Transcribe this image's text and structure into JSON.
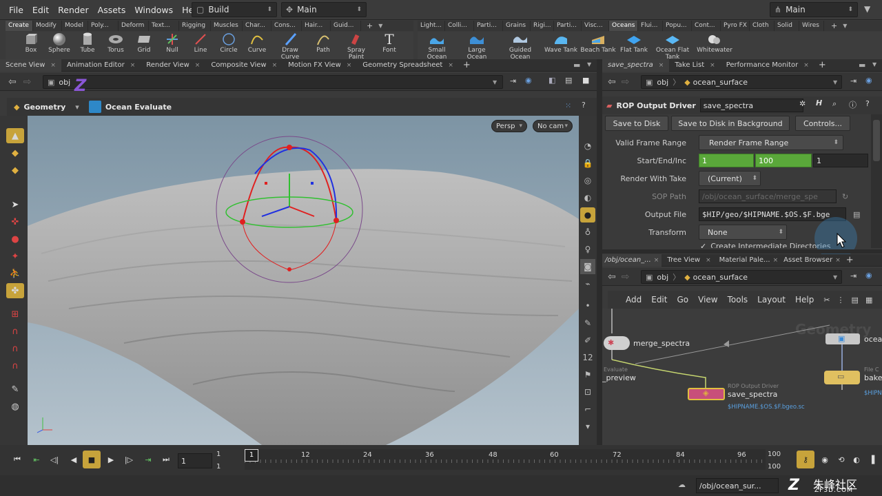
{
  "menubar": {
    "items": [
      "File",
      "Edit",
      "Render",
      "Assets",
      "Windows",
      "Help"
    ],
    "desktop": "Build",
    "context": "Main",
    "workspace": "Main"
  },
  "shelf_left": {
    "tabs": [
      "Create",
      "Modify",
      "Model",
      "Poly...",
      "Deform",
      "Text...",
      "Rigging",
      "Muscles",
      "Char...",
      "Cons...",
      "Hair...",
      "Guid..."
    ],
    "tools": [
      "Box",
      "Sphere",
      "Tube",
      "Torus",
      "Grid",
      "Null",
      "Line",
      "Circle",
      "Curve",
      "Draw Curve",
      "Path",
      "Spray Paint",
      "Font"
    ]
  },
  "shelf_right": {
    "tabs": [
      "Light...",
      "Colli...",
      "Parti...",
      "Grains",
      "Rigi...",
      "Parti...",
      "Visc...",
      "Oceans",
      "Flui...",
      "Popu...",
      "Cont...",
      "Pyro FX",
      "Cloth",
      "Solid",
      "Wires"
    ],
    "active_tab": "Oceans",
    "tools": [
      "Small Ocean",
      "Large Ocean",
      "Guided Ocean Layer",
      "Wave Tank",
      "Beach Tank",
      "Flat Tank",
      "Ocean Flat Tank",
      "Whitewater"
    ]
  },
  "viewer": {
    "tabs": [
      "Scene View",
      "Animation Editor",
      "Render View",
      "Composite View",
      "Motion FX View",
      "Geometry Spreadsheet"
    ],
    "path": "obj",
    "context_label": "Geometry",
    "node_label": "Ocean Evaluate",
    "persp": "Persp",
    "cam": "No cam"
  },
  "params": {
    "tabs": [
      "save_spectra",
      "Take List",
      "Performance Monitor"
    ],
    "path_root": "obj",
    "path_node": "ocean_surface",
    "node_type": "ROP Output Driver",
    "node_name": "save_spectra",
    "buttons": [
      "Save to Disk",
      "Save to Disk in Background",
      "Controls..."
    ],
    "rows": {
      "valid_range_label": "Valid Frame Range",
      "valid_range_value": "Render Frame Range",
      "start_end_label": "Start/End/Inc",
      "start": "1",
      "end": "100",
      "inc": "1",
      "take_label": "Render With Take",
      "take_value": "(Current)",
      "sop_label": "SOP Path",
      "sop_value": "/obj/ocean_surface/merge_spe",
      "output_label": "Output File",
      "output_value": "$HIP/geo/$HIPNAME.$OS.$F.bge",
      "transform_label": "Transform",
      "transform_value": "None",
      "intermediate": "Create Intermediate Directories"
    }
  },
  "network": {
    "tabs": [
      "/obj/ocean_...",
      "Tree View",
      "Material Pale...",
      "Asset Browser"
    ],
    "path_root": "obj",
    "path_node": "ocean_surface",
    "menu": [
      "Add",
      "Edit",
      "Go",
      "View",
      "Tools",
      "Layout",
      "Help"
    ],
    "watermark": "Geometry",
    "nodes": {
      "merge": "merge_spectra",
      "evaluate_type": "Evaluate",
      "preview": "_preview",
      "rop_type": "ROP Output Driver",
      "rop_name": "save_spectra",
      "rop_file": "$HIPNAME.$OS.$F.bgeo.sc",
      "ocean": "ocea",
      "file_type": "File C",
      "bake": "bake",
      "bake_file": "$HIPN"
    }
  },
  "timeline": {
    "current_frame": "1",
    "start": "1",
    "start2": "1",
    "end": "100",
    "end2": "100",
    "ticks": [
      "1",
      "12",
      "24",
      "36",
      "48",
      "60",
      "72",
      "84",
      "96"
    ]
  },
  "status": {
    "path": "/obj/ocean_sur..."
  },
  "logo": "ZF3D.COM"
}
